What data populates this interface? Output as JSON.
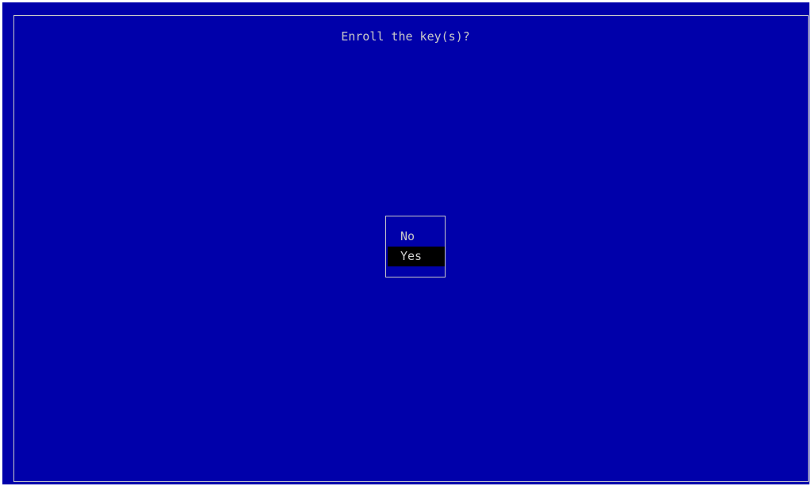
{
  "dialog": {
    "title": "Enroll the key(s)?",
    "options": [
      {
        "label": "No",
        "selected": false
      },
      {
        "label": "Yes",
        "selected": true
      }
    ]
  },
  "colors": {
    "background": "#0000aa",
    "text": "#c8c8c8",
    "highlight": "#000000"
  }
}
